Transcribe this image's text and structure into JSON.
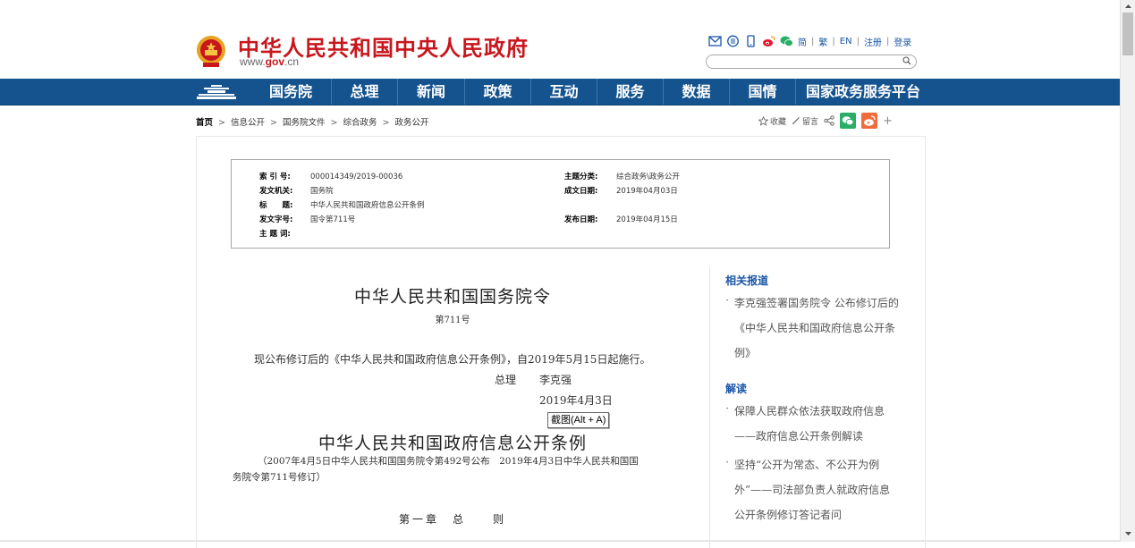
{
  "header": {
    "site_title": "中华人民共和国中央人民政府",
    "site_url_prefix": "www.",
    "site_url_domain": "gov",
    "site_url_suffix": ".cn",
    "lang_simplified": "简",
    "lang_traditional": "繁",
    "lang_english": "EN",
    "register": "注册",
    "login": "登录",
    "separator": "|",
    "search_placeholder": ""
  },
  "nav": {
    "items": [
      "国务院",
      "总理",
      "新闻",
      "政策",
      "互动",
      "服务",
      "数据",
      "国情",
      "国家政务服务平台"
    ]
  },
  "breadcrumb": {
    "home": "首页",
    "gt": ">",
    "items": [
      "信息公开",
      "国务院文件",
      "综合政务",
      "政务公开"
    ]
  },
  "tools": {
    "favorite": "收藏",
    "comment": "留言",
    "more": "+"
  },
  "meta": {
    "index_no_label": "索 引 号:",
    "index_no": "000014349/2019-00036",
    "issuer_label": "发文机关:",
    "issuer": "国务院",
    "title_label": "标　　题:",
    "title": "中华人民共和国政府信息公开条例",
    "doc_no_label": "发文字号:",
    "doc_no": "国令第711号",
    "keywords_label": "主 题 词:",
    "keywords": "",
    "category_label": "主题分类:",
    "category": "综合政务\\政务公开",
    "date_written_label": "成文日期:",
    "date_written": "2019年04月03日",
    "date_published_label": "发布日期:",
    "date_published": "2019年04月15日"
  },
  "article": {
    "order_title": "中华人民共和国国务院令",
    "order_no": "第711号",
    "promulgation": "现公布修订后的《中华人民共和国政府信息公开条例》，自2019年5月15日起施行。",
    "sign_role": "总理",
    "sign_name": "李克强",
    "sign_date": "2019年4月3日",
    "tooltip": "截图(Alt + A)",
    "regulation_title": "中华人民共和国政府信息公开条例",
    "regulation_sub_line1": "（2007年4月5日中华人民共和国国务院令第492号公布　2019年4月3日中华人民共和国国",
    "regulation_sub_line2": "务院令第711号修订）",
    "chapter": "第一章　总　　则"
  },
  "sidebar": {
    "related_head": "相关报道",
    "related_items": [
      "李克强签署国务院令 公布修订后的《中华人民共和国政府信息公开条例》"
    ],
    "interpret_head": "解读",
    "interpret_items": [
      "保障人民群众依法获取政府信息——政府信息公开条例解读",
      "坚持“公开为常态、不公开为例外”——司法部负责人就政府信息公开条例修订答记者问"
    ]
  },
  "colors": {
    "brand_red": "#c8161d",
    "nav_blue": "#14538e",
    "link_blue": "#1a56a8",
    "wechat_green": "#2aae67",
    "weibo_orange": "#f06c3c"
  },
  "icons": [
    "national-emblem-icon",
    "mail-icon",
    "rss-icon",
    "mobile-icon",
    "weibo-icon",
    "wechat-icon",
    "search-icon",
    "tiananmen-home-icon",
    "star-icon",
    "pencil-icon",
    "share-icon"
  ]
}
